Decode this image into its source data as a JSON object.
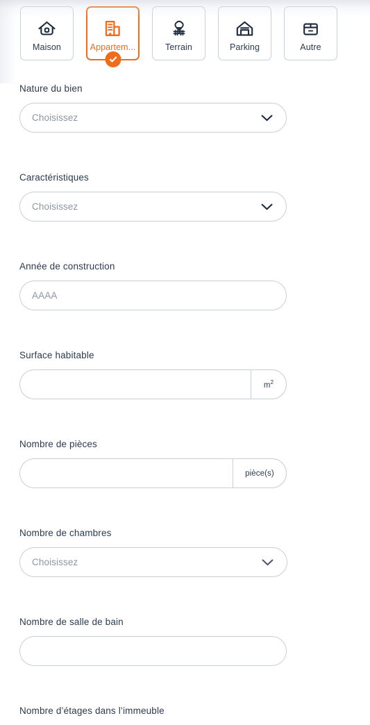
{
  "property_types": [
    {
      "id": "maison",
      "label": "Maison",
      "icon": "house-icon",
      "selected": false
    },
    {
      "id": "appartement",
      "label": "Appartem...",
      "icon": "building-icon",
      "selected": true
    },
    {
      "id": "terrain",
      "label": "Terrain",
      "icon": "tree-fence-icon",
      "selected": false
    },
    {
      "id": "parking",
      "label": "Parking",
      "icon": "garage-icon",
      "selected": false
    },
    {
      "id": "autre",
      "label": "Autre",
      "icon": "box-icon",
      "selected": false
    }
  ],
  "selected_badge_icon": "check-circle-icon",
  "fields": {
    "nature": {
      "label": "Nature du bien",
      "type": "select",
      "placeholder": "Choisissez",
      "value": "",
      "chevron_icon": "chevron-down-icon"
    },
    "caracteristiques": {
      "label": "Caractéristiques",
      "type": "select",
      "placeholder": "Choisissez",
      "value": "",
      "chevron_icon": "chevron-down-icon"
    },
    "annee": {
      "label": "Année de construction",
      "type": "text",
      "placeholder": "AAAA",
      "value": ""
    },
    "surface": {
      "label": "Surface habitable",
      "type": "text",
      "placeholder": "",
      "value": "",
      "suffix": "m",
      "suffix_exponent": "2"
    },
    "pieces": {
      "label": "Nombre de pièces",
      "type": "text",
      "placeholder": "",
      "value": "",
      "suffix": "pièce(s)"
    },
    "chambres": {
      "label": "Nombre de chambres",
      "type": "select",
      "placeholder": "Choisissez",
      "value": "",
      "chevron_icon": "chevron-down-icon"
    },
    "salle_de_bain": {
      "label": "Nombre de salle de bain",
      "type": "text",
      "placeholder": "",
      "value": ""
    },
    "etages": {
      "label": "Nombre d’étages dans l’immeuble",
      "type": "text",
      "placeholder": "",
      "value": ""
    }
  },
  "colors": {
    "accent": "#ef6c1a",
    "text": "#2b3a4f",
    "placeholder": "#8c95a4",
    "border": "#c7cfda",
    "background": "#ffffff"
  }
}
